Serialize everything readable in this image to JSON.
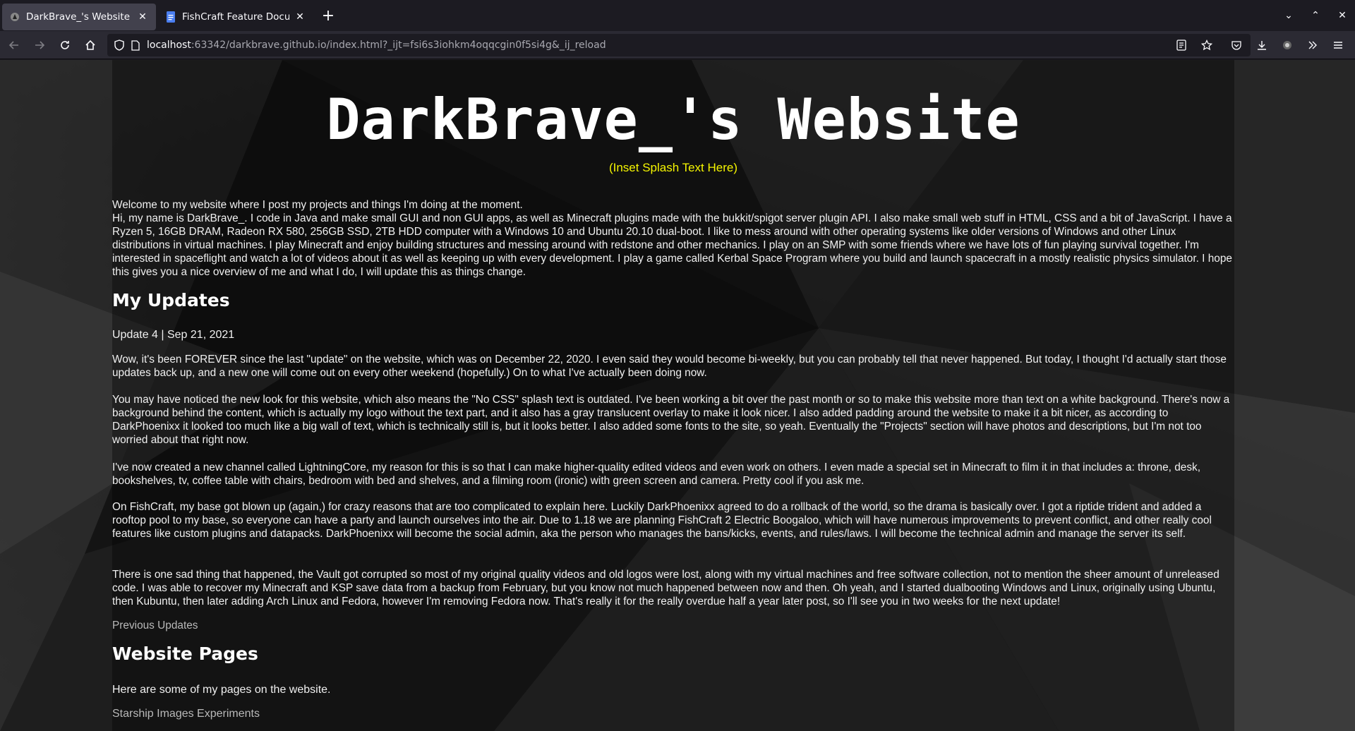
{
  "browser": {
    "tabs": [
      {
        "title": "DarkBrave_'s Website",
        "active": true
      },
      {
        "title": "FishCraft Feature Documen",
        "active": false
      }
    ],
    "url_host": "localhost",
    "url_rest": ":63342/darkbrave.github.io/index.html?_ijt=fsi6s3iohkm4oqqcgin0f5si4g&_ij_reload"
  },
  "page": {
    "title": "DarkBrave_'s Website",
    "splash": "(Inset Splash Text Here)",
    "intro_line": "Welcome to my website where I post my projects and things I'm doing at the moment.",
    "intro_body": "Hi, my name is DarkBrave_. I code in Java and make small GUI and non GUI apps, as well as Minecraft plugins made with the bukkit/spigot server plugin API. I also make small web stuff in HTML, CSS and a bit of JavaScript. I have a Ryzen 5, 16GB DRAM, Radeon RX 580, 256GB SSD, 2TB HDD computer with a Windows 10 and Ubuntu 20.10 dual-boot. I like to mess around with other operating systems like older versions of Windows and other Linux distributions in virtual machines. I play Minecraft and enjoy building structures and messing around with redstone and other mechanics. I play on an SMP with some friends where we have lots of fun playing survival together. I'm interested in spaceflight and watch a lot of videos about it as well as keeping up with every development. I play a game called Kerbal Space Program where you build and launch spacecraft in a mostly realistic physics simulator. I hope this gives you a nice overview of me and what I do, I will update this as things change.",
    "updates_heading": "My Updates",
    "update_title": "Update 4 | Sep 21, 2021",
    "update_paragraphs": [
      "Wow, it's been FOREVER since the last \"update\" on the website, which was on December 22, 2020. I even said they would become bi-weekly, but you can probably tell that never happened. But today, I thought I'd actually start those updates back up, and a new one will come out on every other weekend (hopefully.) On to what I've actually been doing now.",
      "You may have noticed the new look for this website, which also means the \"No CSS\" splash text is outdated. I've been working a bit over the past month or so to make this website more than text on a white background. There's now a background behind the content, which is actually my logo without the text part, and it also has a gray translucent overlay to make it look nicer. I also added padding around the website to make it a bit nicer, as according to DarkPhoenixx it looked too much like a big wall of text, which is technically still is, but it looks better. I also added some fonts to the site, so yeah. Eventually the \"Projects\" section will have photos and descriptions, but I'm not too worried about that right now.",
      "I've now created a new channel called LightningCore, my reason for this is so that I can make higher-quality edited videos and even work on others. I even made a special set in Minecraft to film it in that includes a: throne, desk, bookshelves, tv, coffee table with chairs, bedroom with bed and shelves, and a filming room (ironic) with green screen and camera. Pretty cool if you ask me.",
      "On FishCraft, my base got blown up (again,) for crazy reasons that are too complicated to explain here. Luckily DarkPhoenixx agreed to do a rollback of the world, so the drama is basically over. I got a riptide trident and added a rooftop pool to my base, so everyone can have a party and launch ourselves into the air. Due to 1.18 we are planning FishCraft 2 Electric Boogaloo, which will have numerous improvements to prevent conflict, and other really cool features like custom plugins and datapacks. DarkPhoenixx will become the social admin, aka the person who manages the bans/kicks, events, and rules/laws. I will become the technical admin and manage the server its self.",
      "There is one sad thing that happened, the Vault got corrupted so most of my original quality videos and old logos were lost, along with my virtual machines and free software collection, not to mention the sheer amount of unreleased code. I was able to recover my Minecraft and KSP save data from a backup from February, but you know not much happened between now and then. Oh yeah, and I started dualbooting Windows and Linux, originally using Ubuntu, then Kubuntu, then later adding Arch Linux and Fedora, however I'm removing Fedora now. That's really it for the really overdue half a year later post, so I'll see you in two weeks for the next update!"
    ],
    "previous_updates_link": "Previous Updates",
    "pages_heading": "Website Pages",
    "pages_intro": "Here are some of my pages on the website.",
    "pages_links": [
      "Starship Images Experiments"
    ]
  }
}
